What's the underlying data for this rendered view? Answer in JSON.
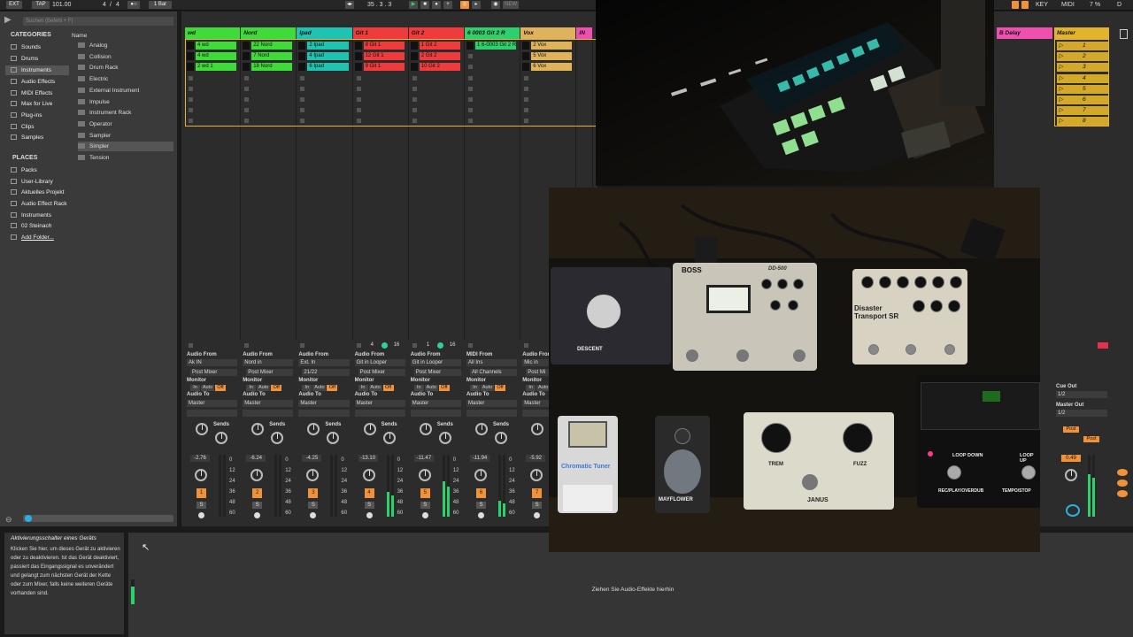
{
  "transport": {
    "ext": "EXT",
    "tap": "TAP",
    "tempo": "101.00",
    "sig_num": "4",
    "sig_den": "4",
    "quant": "1 Bar",
    "position": "35 .   3 .   3",
    "new": "NEW",
    "key": "KEY",
    "midi": "MIDI",
    "cpu": "7 %",
    "d": "D"
  },
  "browser": {
    "search_placeholder": "Suchen (Befehl + F)",
    "categories_header": "CATEGORIES",
    "name_header": "Name",
    "categories": [
      "Sounds",
      "Drums",
      "Instruments",
      "Audio Effects",
      "MIDI Effects",
      "Max for Live",
      "Plug-ins",
      "Clips",
      "Samples"
    ],
    "places_header": "PLACES",
    "places": [
      "Packs",
      "User-Library",
      "Aktuelles Projekt",
      "Audio Effect Rack",
      "Instruments",
      "02 Steinach",
      "Add Folder..."
    ],
    "items": [
      "Analog",
      "Collision",
      "Drum Rack",
      "Electric",
      "External Instrument",
      "Impulse",
      "Instrument Rack",
      "Operator",
      "Sampler",
      "Simpler",
      "Tension"
    ]
  },
  "tracks": [
    {
      "name": "wd",
      "color": "#3fdc39",
      "clips": [
        "4 wd",
        "4 wd",
        "2 wd 1"
      ],
      "audio_from": "Ak IN",
      "audio_from_sub": "Post Mixer",
      "audio_to": "Master",
      "vol": "-2.76",
      "num": "1"
    },
    {
      "name": "Nord",
      "color": "#3fdc39",
      "clips": [
        "22 Nord",
        "7 Nord",
        "18 Nord"
      ],
      "audio_from": "Nord in",
      "audio_from_sub": "Post Mixer",
      "audio_to": "Master",
      "vol": "-6.24",
      "num": "2"
    },
    {
      "name": "Ipad",
      "color": "#1ec4b1",
      "clips": [
        "2 Ipad",
        "4 Ipad",
        "6 Ipad"
      ],
      "audio_from": "Ext. In",
      "audio_from_sub": "21/22",
      "audio_to": "Master",
      "vol": "-4.25",
      "num": "3"
    },
    {
      "name": "Git 1",
      "color": "#ef3b3b",
      "clips": [
        "8 Git 1",
        "12 Git 1",
        "9 Git 1"
      ],
      "audio_from": "Git in Looper",
      "audio_from_sub": "Post Mixer",
      "audio_to": "Master",
      "vol": "-13.10",
      "num": "4"
    },
    {
      "name": "Git 2",
      "color": "#ef3b3b",
      "clips": [
        "1 Git 2",
        "2 Git 2",
        "10 Git 2"
      ],
      "audio_from": "Git in Looper",
      "audio_from_sub": "Post Mixer",
      "audio_to": "Master",
      "vol": "-11.47",
      "num": "5"
    },
    {
      "name": "6 0003 Git 2 R",
      "color": "#2ed06b",
      "clips": [
        "1 6-0003 Git 2 R",
        "",
        ""
      ],
      "audio_from": "All Ins",
      "audio_from_sub": "All Channels",
      "audio_to": "Master",
      "vol": "-11.94",
      "num": "6",
      "midi": true
    },
    {
      "name": "Vox",
      "color": "#e0b35a",
      "clips": [
        "2 Vox",
        "5 Vox",
        "6 Vox"
      ],
      "audio_from": "Mic in",
      "audio_from_sub": "Post Mi",
      "audio_to": "Master",
      "vol": "-5.92",
      "num": "7"
    },
    {
      "name": "IN",
      "color": "#ef4fae",
      "clips": [
        "",
        "",
        ""
      ],
      "audio_from": "",
      "audio_from_sub": "",
      "audio_to": "",
      "vol": "",
      "num": ""
    }
  ],
  "labels": {
    "audio_from": "Audio From",
    "midi_from": "MIDI From",
    "monitor": "Monitor",
    "audio_to": "Audio To",
    "sends": "Sends",
    "in": "In",
    "auto": "Auto",
    "off": "Off",
    "s": "S",
    "cue_out": "Cue Out",
    "master_out": "Master Out",
    "cue_val": "1/2",
    "master_val": "1/2",
    "post": "Post",
    "count_a": "4",
    "count_b": "16",
    "count_c": "1",
    "count_d": "16"
  },
  "scale": [
    "0",
    "12",
    "24",
    "36",
    "48",
    "60"
  ],
  "return_track": {
    "name": "B Delay",
    "color": "#ef4fae"
  },
  "master": {
    "name": "Master",
    "color": "#e3b42a",
    "scenes": [
      "1",
      "2",
      "3",
      "4",
      "5",
      "6",
      "7",
      "8"
    ],
    "vol": "0.49"
  },
  "info": {
    "title": "Aktivierungsschalter eines Geräts",
    "body": "Klicken Sie hier, um dieses Gerät zu aktivieren oder zu deaktivieren. Ist das Gerät deaktiviert, passiert das Eingangssignal es unverändert und gelangt zum nächsten Gerät der Kette oder zum Mixer, falls keine weiteren Geräte vorhanden sind."
  },
  "drop_hint": "Ziehen Sie Audio-Effekte hierhin",
  "pedals": {
    "boss": "BOSS",
    "boss_model": "DD-500",
    "disaster": "Disaster Transport SR",
    "descent": "DESCENT",
    "tuner": "Chromatic Tuner",
    "mayflower": "MAYFLOWER",
    "janus": "JANUS",
    "trem": "TREM",
    "fuzz": "FUZZ",
    "loop_down": "LOOP DOWN",
    "play_overdub": "REC/PLAY/OVERDUB",
    "tempo_stop": "TEMPO/STOP",
    "loop_up": "LOOP UP"
  }
}
